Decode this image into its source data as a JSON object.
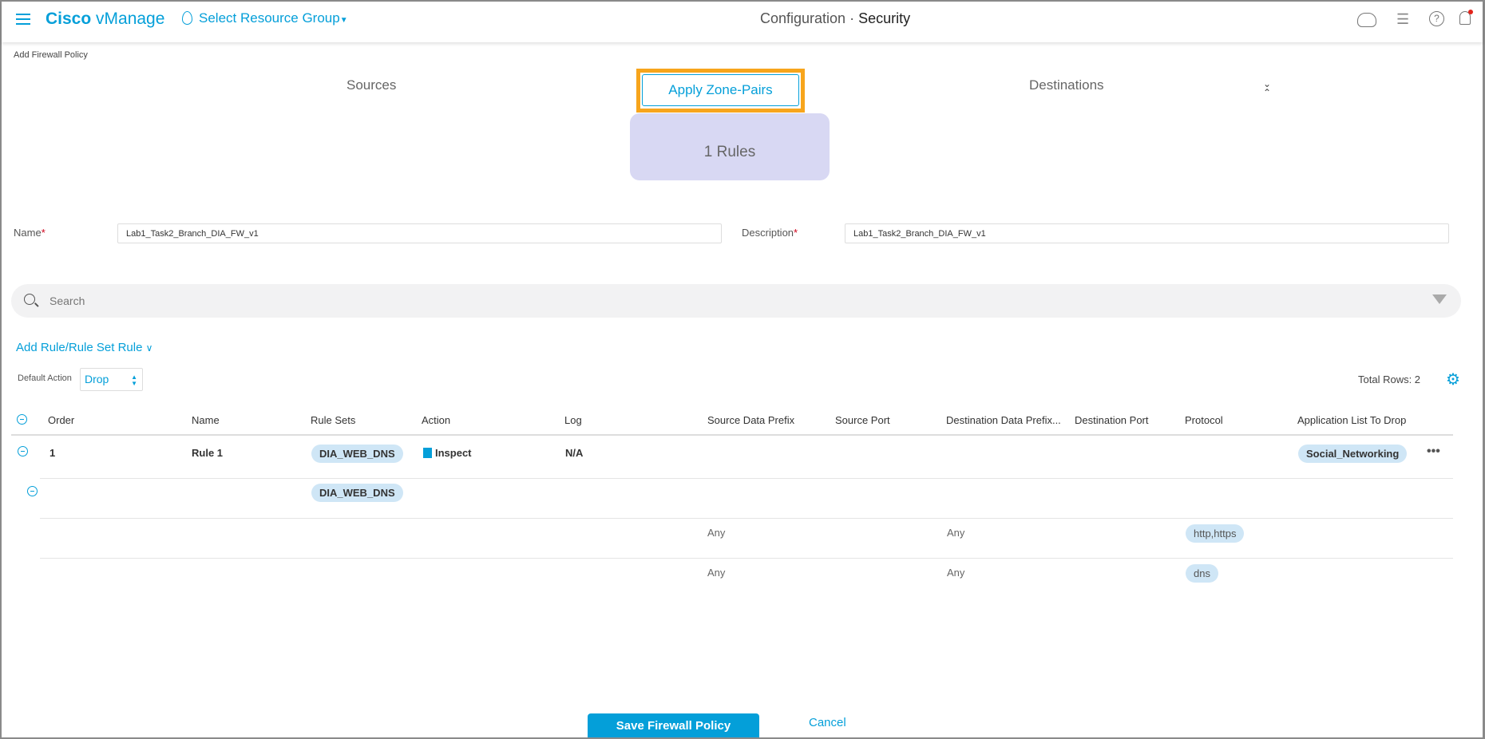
{
  "header": {
    "app_brand": "Cisco",
    "app_name": "vManage",
    "resource_group": "Select Resource Group",
    "title_prefix": "Configuration",
    "title_sep": "·",
    "title_current": "Security",
    "icons": [
      "menu-icon",
      "location-pin-icon",
      "cloud-icon",
      "tasks-list-icon",
      "help-icon",
      "bell-icon"
    ]
  },
  "breadcrumb": "Add Firewall Policy",
  "steps": {
    "sources": "Sources",
    "apply": "Apply Zone-Pairs",
    "destinations": "Destinations",
    "rules_count": "1 Rules"
  },
  "form": {
    "name_label": "Name",
    "name_value": "Lab1_Task2_Branch_DIA_FW_v1",
    "description_label": "Description",
    "description_value": "Lab1_Task2_Branch_DIA_FW_v1",
    "required_mark": "*"
  },
  "search": {
    "placeholder": "Search"
  },
  "add_rule": "Add Rule/Rule Set Rule",
  "default_action": {
    "label": "Default Action",
    "value": "Drop"
  },
  "total_rows": "Total Rows: 2",
  "table": {
    "columns": [
      "Order",
      "Name",
      "Rule Sets",
      "Action",
      "Log",
      "Source Data Prefix",
      "Source Port",
      "Destination Data Prefix...",
      "Destination Port",
      "Protocol",
      "Application List To Drop"
    ],
    "rule": {
      "order": "1",
      "name": "Rule 1",
      "rule_set": "DIA_WEB_DNS",
      "action": "Inspect",
      "log": "N/A",
      "app_list": "Social_Networking"
    },
    "rule_set_row": {
      "rule_set": "DIA_WEB_DNS"
    },
    "sub_rows": [
      {
        "source_prefix": "Any",
        "dest_prefix": "Any",
        "protocol": "http,https"
      },
      {
        "source_prefix": "Any",
        "dest_prefix": "Any",
        "protocol": "dns"
      }
    ]
  },
  "footer": {
    "save": "Save Firewall Policy",
    "cancel": "Cancel"
  },
  "colors": {
    "accent": "#049fd9",
    "highlight": "#f7a51c",
    "rules_box": "#d8d8f3",
    "pill": "#cfe6f6"
  }
}
